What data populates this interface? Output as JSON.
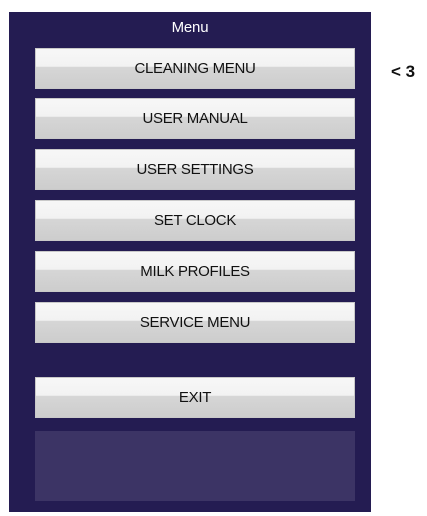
{
  "screen": {
    "title": "Menu",
    "menu_items": [
      {
        "label": "CLEANING MENU"
      },
      {
        "label": "USER MANUAL"
      },
      {
        "label": "USER SETTINGS"
      },
      {
        "label": "SET CLOCK"
      },
      {
        "label": "MILK PROFILES"
      },
      {
        "label": "SERVICE MENU"
      }
    ],
    "exit_label": "EXIT"
  },
  "annotation": {
    "text": "< 3"
  },
  "colors": {
    "screen_background": "#241c52",
    "panel_background": "#3c3465",
    "button_face": "#f2f2f2"
  }
}
